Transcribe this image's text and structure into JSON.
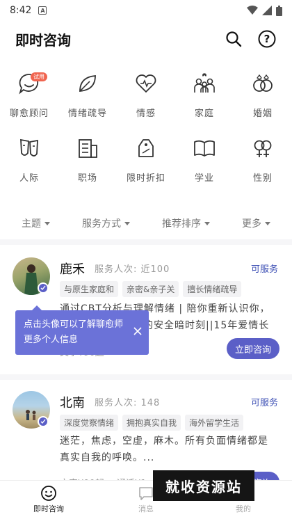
{
  "status": {
    "time": "8:42"
  },
  "header": {
    "title": "即时咨询"
  },
  "categories": [
    {
      "label": "聊愈顾问",
      "icon": "chat-bubble-icon",
      "badge": "试用"
    },
    {
      "label": "情绪疏导",
      "icon": "leaf-icon"
    },
    {
      "label": "情感",
      "icon": "heart-pulse-icon"
    },
    {
      "label": "家庭",
      "icon": "family-icon"
    },
    {
      "label": "婚姻",
      "icon": "rings-icon"
    },
    {
      "label": "人际",
      "icon": "masks-icon"
    },
    {
      "label": "职场",
      "icon": "office-building-icon"
    },
    {
      "label": "限时折扣",
      "icon": "discount-tag-icon"
    },
    {
      "label": "学业",
      "icon": "open-book-icon"
    },
    {
      "label": "性别",
      "icon": "gender-icon"
    }
  ],
  "filters": [
    "主题",
    "服务方式",
    "推荐排序",
    "更多"
  ],
  "counselors": [
    {
      "name": "鹿禾",
      "count": "服务人次: 近100",
      "status": "可服务",
      "tags": [
        "与原生家庭和",
        "亲密&亲子关",
        "擅长情绪疏导"
      ],
      "desc": "通过CBT分析与理解情绪 | 陪你重新认识你，并在这里安放情绪的安全暗时刻||15年爱情长跑+...",
      "price": "文字¥90起",
      "button": "立即咨询"
    },
    {
      "name": "北南",
      "count": "服务人次: 148",
      "status": "可服务",
      "tags": [
        "深度觉察情绪",
        "拥抱真实自我",
        "海外留学生活"
      ],
      "desc": "迷茫，焦虑，空虚，麻木。所有负面情绪都是真实自我的呼唤。...",
      "price": "文字¥90起",
      "price2": "通话¥1",
      "button": "立即咨询"
    }
  ],
  "tooltip": {
    "line1": "点击头像可以了解聊愈师",
    "line2": "更多个人信息"
  },
  "nav": [
    {
      "label": "即时咨询",
      "icon": "smile-icon"
    },
    {
      "label": "消息",
      "icon": "message-icon"
    },
    {
      "label": "我的",
      "icon": "profile-icon"
    }
  ],
  "watermark": "就收资源站",
  "colors": {
    "accent": "#5b5fc7",
    "link": "#3f51b5",
    "badge": "#f0644f"
  }
}
